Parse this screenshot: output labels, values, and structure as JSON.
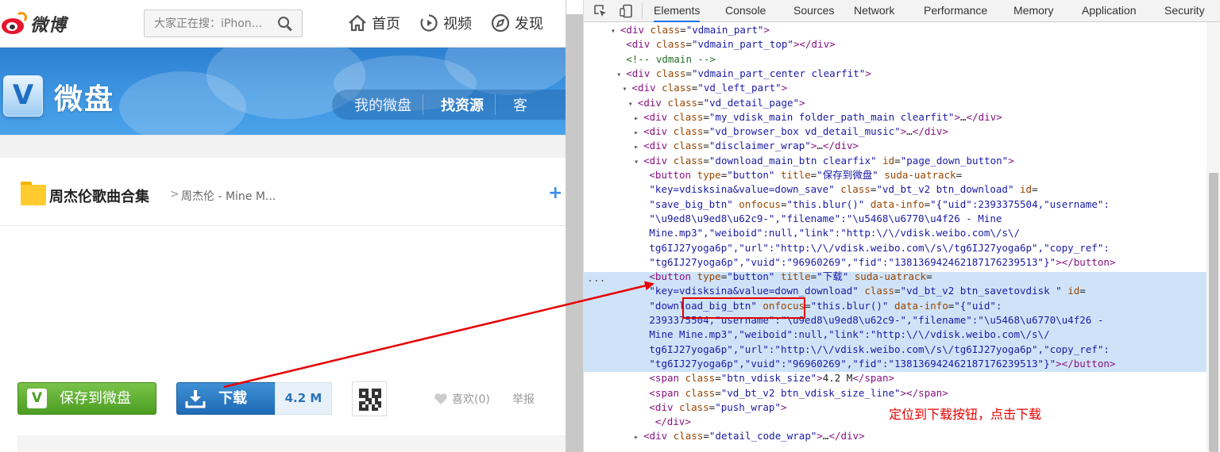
{
  "weibo": {
    "logo_text": "微博",
    "search_placeholder": "大家正在搜：iPhon...",
    "nav": [
      {
        "label": "首页",
        "icon": "home-icon"
      },
      {
        "label": "视频",
        "icon": "video-icon"
      },
      {
        "label": "发现",
        "icon": "compass-icon"
      }
    ]
  },
  "vdisk": {
    "logo_letter": "V",
    "title": "微盘",
    "tabs": [
      {
        "label": "我的微盘",
        "active": false
      },
      {
        "label": "找资源",
        "active": true
      },
      {
        "label": "客",
        "active": false
      }
    ]
  },
  "breadcrumb": {
    "folder_title": "周杰伦歌曲合集",
    "separator": ">",
    "file": "周杰伦 - Mine M...",
    "plus": "+"
  },
  "actions": {
    "save_icon_letter": "V",
    "save_label": "保存到微盘",
    "download_label": "下载",
    "file_size": "4.2 M",
    "like_label": "喜欢(0)",
    "report_label": "举报"
  },
  "devtools": {
    "tabs": [
      "Elements",
      "Console",
      "Sources",
      "Network",
      "Performance",
      "Memory",
      "Application",
      "Security"
    ],
    "active_tab": "Elements",
    "more_dots": "...",
    "dom_lines": [
      {
        "indent": 3,
        "tri": "▾",
        "html": "<span class='tag'>&lt;div</span> <span class='an'>class</span>=<span class='av'>\"vdmain_part\"</span><span class='tag'>&gt;</span>"
      },
      {
        "indent": 4,
        "tri": "",
        "html": "<span class='tag'>&lt;div</span> <span class='an'>class</span>=<span class='av'>\"vdmain_part_top\"</span><span class='tag'>&gt;&lt;/div&gt;</span>"
      },
      {
        "indent": 4,
        "tri": "",
        "html": "<span class='cm'>&lt;!-- vdmain --&gt;</span>"
      },
      {
        "indent": 4,
        "tri": "▾",
        "html": "<span class='tag'>&lt;div</span> <span class='an'>class</span>=<span class='av'>\"vdmain_part_center clearfit\"</span><span class='tag'>&gt;</span>"
      },
      {
        "indent": 5,
        "tri": "▾",
        "html": "<span class='tag'>&lt;div</span> <span class='an'>class</span>=<span class='av'>\"vd_left_part\"</span><span class='tag'>&gt;</span>"
      },
      {
        "indent": 6,
        "tri": "▾",
        "html": "<span class='tag'>&lt;div</span> <span class='an'>class</span>=<span class='av'>\"vd_detail_page\"</span><span class='tag'>&gt;</span>"
      },
      {
        "indent": 7,
        "tri": "▸",
        "html": "<span class='tag'>&lt;div</span> <span class='an'>class</span>=<span class='av'>\"my_vdisk_main folder_path_main clearfit\"</span><span class='tag'>&gt;</span>…<span class='tag'>&lt;/div&gt;</span>"
      },
      {
        "indent": 7,
        "tri": "▸",
        "html": "<span class='tag'>&lt;div</span> <span class='an'>class</span>=<span class='av'>\"vd_browser_box vd_detail_music\"</span><span class='tag'>&gt;</span>…<span class='tag'>&lt;/div&gt;</span>"
      },
      {
        "indent": 7,
        "tri": "▸",
        "html": "<span class='tag'>&lt;div</span> <span class='an'>class</span>=<span class='av'>\"disclaimer_wrap\"</span><span class='tag'>&gt;</span>…<span class='tag'>&lt;/div&gt;</span>"
      },
      {
        "indent": 7,
        "tri": "▾",
        "html": "<span class='tag'>&lt;div</span> <span class='an'>class</span>=<span class='av'>\"download_main_btn clearfix\"</span> <span class='an'>id</span>=<span class='av'>\"page_down_button\"</span><span class='tag'>&gt;</span>"
      },
      {
        "indent": 8,
        "tri": "",
        "html": "<span class='tag'>&lt;button</span> <span class='an'>type</span>=<span class='av'>\"button\"</span> <span class='an'>title</span>=<span class='av'>\"保存到微盘\"</span> <span class='an'>suda-uatrack</span>="
      },
      {
        "indent": 8,
        "tri": "",
        "html": "<span class='av'>\"key=vdisksina&amp;value=down_save\"</span> <span class='an'>class</span>=<span class='av'>\"vd_bt_v2 btn_download\"</span> <span class='an'>id</span>="
      },
      {
        "indent": 8,
        "tri": "",
        "html": "<span class='av'>\"save_big_btn\"</span> <span class='an'>onfocus</span>=<span class='av'>\"this.blur()\"</span> <span class='an'>data-info</span>=<span class='av'>\"{\"uid\":2393375504,\"username\":</span>"
      },
      {
        "indent": 8,
        "tri": "",
        "html": "<span class='av'>\"\\u9ed8\\u9ed8\\u62c9-\",\"filename\":\"\\u5468\\u6770\\u4f26 - Mine</span>"
      },
      {
        "indent": 8,
        "tri": "",
        "html": "<span class='av'>Mine.mp3\",\"weiboid\":null,\"link\":\"http:\\/\\/vdisk.weibo.com\\/s\\/</span>"
      },
      {
        "indent": 8,
        "tri": "",
        "html": "<span class='av'>tg6IJ27yoga6p\",\"url\":\"http:\\/\\/vdisk.weibo.com\\/s\\/tg6IJ27yoga6p\",\"copy_ref\":</span>"
      },
      {
        "indent": 8,
        "tri": "",
        "html": "<span class='av'>\"tg6IJ27yoga6p\",\"vuid\":\"96960269\",\"fid\":\"13813694246218717623951З\"}\"</span><span class='tag'>&gt;&lt;/button&gt;</span>"
      },
      {
        "indent": 8,
        "tri": "",
        "html": "<span class='tag'>&lt;button</span> <span class='an'>type</span>=<span class='av'>\"button\"</span> <span class='an'>title</span>=<span class='av'>\"下载\"</span> <span class='an'>suda-uatrack</span>="
      },
      {
        "indent": 8,
        "tri": "",
        "html": "<span class='av'>\"key=vdisksina&amp;value=down_download\"</span> <span class='an'>class</span>=<span class='av'>\"vd_bt_v2 btn_savetovdisk \"</span> <span class='an'>id</span>="
      },
      {
        "indent": 8,
        "tri": "",
        "html": "<span class='av'>\"download_big_btn\"</span> <span class='an'>onfocus</span>=<span class='av'>\"this.blur()\"</span> <span class='an'>data-info</span>=<span class='av'>\"{\"uid\":</span>"
      },
      {
        "indent": 8,
        "tri": "",
        "html": "<span class='av'>2393375504,\"username\":\"\\u9ed8\\u9ed8\\u62c9-\",\"filename\":\"\\u5468\\u6770\\u4f26 -</span>"
      },
      {
        "indent": 8,
        "tri": "",
        "html": "<span class='av'>Mine Mine.mp3\",\"weiboid\":null,\"link\":\"http:\\/\\/vdisk.weibo.com\\/s\\/</span>"
      },
      {
        "indent": 8,
        "tri": "",
        "html": "<span class='av'>tg6IJ27yoga6p\",\"url\":\"http:\\/\\/vdisk.weibo.com\\/s\\/tg6IJ27yoga6p\",\"copy_ref\":</span>"
      },
      {
        "indent": 8,
        "tri": "",
        "html": "<span class='av'>\"tg6IJ27yoga6p\",\"vuid\":\"96960269\",\"fid\":\"138136942462187176239513\"}\"</span><span class='tag'>&gt;&lt;/button&gt;</span>"
      },
      {
        "indent": 8,
        "tri": "",
        "html": "<span class='tag'>&lt;span</span> <span class='an'>class</span>=<span class='av'>\"btn_vdisk_size\"</span><span class='tag'>&gt;</span><span class='txt'>4.2 M</span><span class='tag'>&lt;/span&gt;</span>"
      },
      {
        "indent": 8,
        "tri": "",
        "html": "<span class='tag'>&lt;span</span> <span class='an'>class</span>=<span class='av'>\"vd_bt_v2 btn_vdisk_size_line\"</span><span class='tag'>&gt;&lt;/span&gt;</span>"
      },
      {
        "indent": 8,
        "tri": "",
        "html": "<span class='tag'>&lt;div</span> <span class='an'>class</span>=<span class='av'>\"push_wrap\"</span><span class='tag'>&gt;</span>"
      },
      {
        "indent": 9,
        "tri": "",
        "html": "<span class='tag'>&lt;/div&gt;</span>"
      },
      {
        "indent": 7,
        "tri": "▸",
        "html": "<span class='tag'>&lt;div</span> <span class='an'>class</span>=<span class='av'>\"detail_code_wrap\"</span><span class='tag'>&gt;</span>…<span class='tag'>&lt;/div&gt;</span>"
      }
    ]
  },
  "annotation": {
    "note": "定位到下载按钮，点击下载",
    "color": "#e60000"
  },
  "colors": {
    "save_green": "#4c9d23",
    "download_blue": "#1f6ab4",
    "vdisk_blue": "#3b93e0",
    "selection": "#cfe3f8"
  }
}
